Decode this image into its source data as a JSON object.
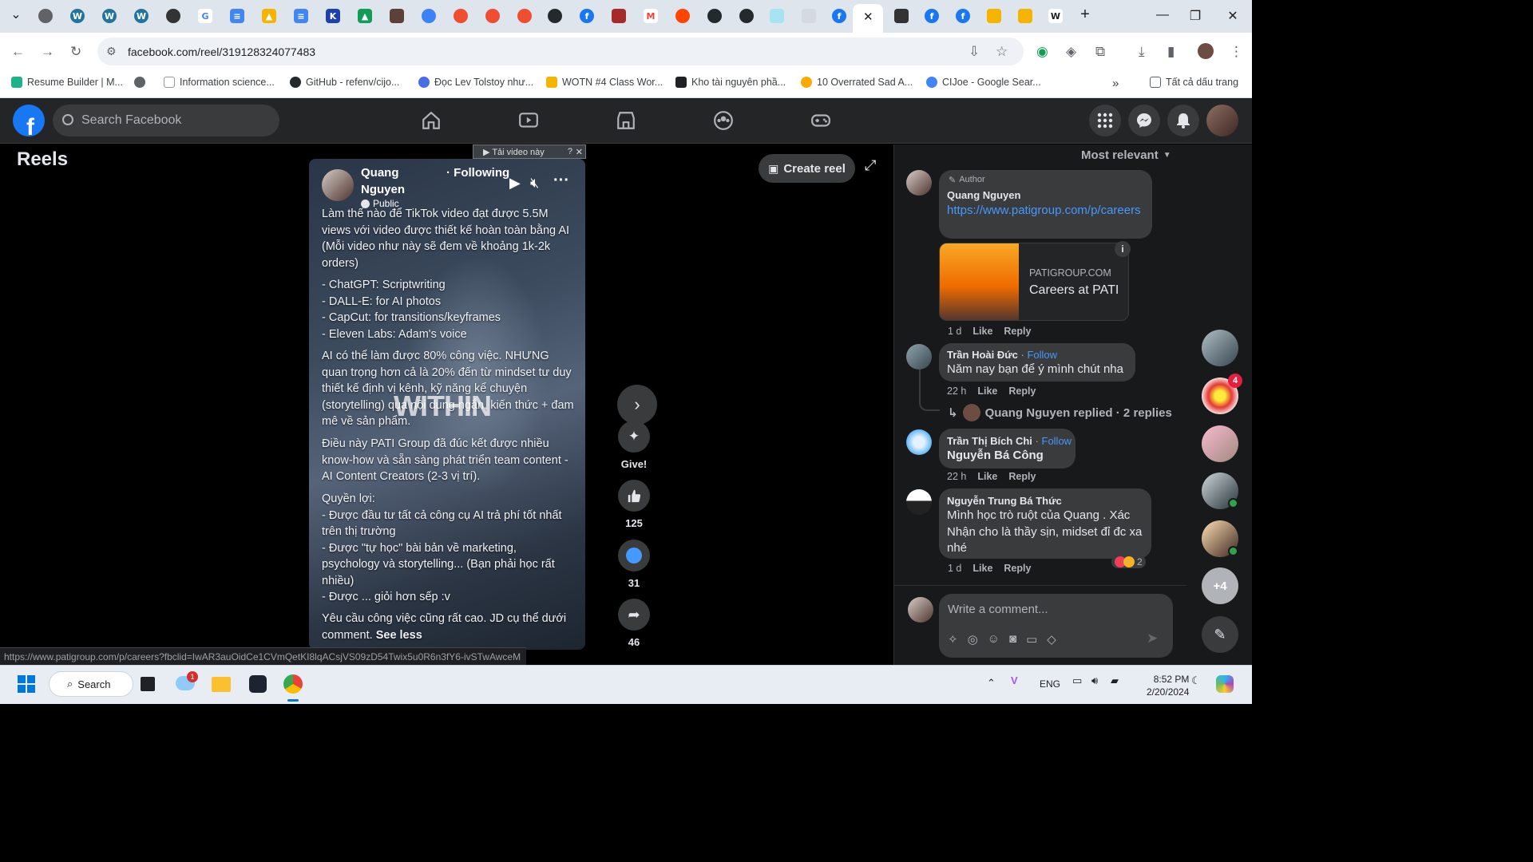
{
  "browser": {
    "url": "facebook.com/reel/319128324077483",
    "close_tab": "✕",
    "new_tab": "+"
  },
  "bookmarks": [
    {
      "label": "Resume Builder | M...",
      "color": "#1fb28a"
    },
    {
      "label": "",
      "color": "#5f6368"
    },
    {
      "label": "Information science...",
      "color": "#202124"
    },
    {
      "label": "GitHub - refenv/cijo...",
      "color": "#24292e"
    },
    {
      "label": "Đọc Lev Tolstoy như...",
      "color": "#4a6de5"
    },
    {
      "label": "WOTN #4 Class Wor...",
      "color": "#f4b400"
    },
    {
      "label": "Kho tài nguyên phầ...",
      "color": "#202124"
    },
    {
      "label": "10 Overrated Sad A...",
      "color": "#f9ab00"
    },
    {
      "label": "CIJoe - Google Sear...",
      "color": "#4285f4"
    }
  ],
  "bookmarks_more": "»",
  "all_bookmarks": "Tất cả dấu trang",
  "fb": {
    "search_placeholder": "Search Facebook",
    "logo_letter": "f"
  },
  "reels_title": "Reels",
  "download_bar": "▶ Tải video này",
  "create_reel": "Create reel",
  "video": {
    "author": "Quang Nguyen",
    "author_line1": "Quang",
    "author_line2": "Nguyen",
    "following": "· Following",
    "privacy": "Public",
    "p1": "Làm thế nào để TikTok video đạt được 5.5M views với video được thiết kế hoàn toàn bằng AI (Mỗi video như này sẽ đem về khoảng 1k-2k orders)",
    "p2_lines": [
      "- ChatGPT: Scriptwriting",
      "- DALL-E: for AI photos",
      "- CapCut: for transitions/keyframes",
      "- Eleven Labs: Adam's voice"
    ],
    "p3": "AI có thể làm được 80% công việc. NHƯNG quan trọng hơn cả là 20% đến từ mindset tư duy thiết kế định vị kênh, kỹ năng kể chuyện (storytelling) qua nội dung ngắn, kiến thức + đam mê về sản phẩm.",
    "p4": "Điều này PATI Group đã đúc kết được nhiều know-how và sẵn sàng phát triển team content - AI Content Creators (2-3 vị trí).",
    "p5_lines": [
      "Quyền lợi:",
      "- Được đầu tư tất cả công cụ AI trả phí tốt nhất trên thị trường",
      "- Được \"tự học\" bài bản về marketing, psychology và storytelling... (Bạn phải học rất nhiều)",
      "- Được ... giỏi hơn sếp :v"
    ],
    "p6": "Yêu cầu công việc cũng rất cao. JD cụ thể dưới comment.",
    "see_less": "See less",
    "overlay_word": "WITHIN"
  },
  "actions": {
    "give": "Give!",
    "likes": "125",
    "comments": "31",
    "shares": "46"
  },
  "comments_panel": {
    "sort": "Most relevant",
    "c1": {
      "badge": "Author",
      "name": "Quang Nguyen",
      "link": "https://www.patigroup.com/p/careers",
      "domain": "PATIGROUP.COM",
      "title": "Careers at PATI",
      "time": "1 d",
      "like": "Like",
      "reply": "Reply"
    },
    "c2": {
      "name": "Trần Hoài Đức",
      "follow": "Follow",
      "text": "Năm nay bạn để ý mình chút nha",
      "time": "22 h",
      "like": "Like",
      "reply": "Reply",
      "replies": "Quang Nguyen replied · 2 replies"
    },
    "c3": {
      "name": "Trần Thị Bích Chi",
      "follow": "Follow",
      "text": "Nguyễn Bá Công",
      "time": "22 h",
      "like": "Like",
      "reply": "Reply"
    },
    "c4": {
      "name": "Nguyễn Trung Bá Thức",
      "text": "Mình học trò ruột của Quang . Xác Nhận cho là thầy sịn, midset đỉ đc xa nhé",
      "time": "1 d",
      "like": "Like",
      "reply": "Reply",
      "reactions": "2"
    },
    "write_placeholder": "Write a comment..."
  },
  "contacts": {
    "badge": "4",
    "more": "+4"
  },
  "status_url": "https://www.patigroup.com/p/careers?fbclid=IwAR3auOidCe1CVmQetKI8lqACsjVS09zD54Twix5u0R6n3fY6-ivSTwAwceM",
  "taskbar": {
    "search": "Search",
    "lang": "ENG",
    "time": "8:52 PM",
    "date": "2/20/2024",
    "mail_badge": "1"
  },
  "colors": {
    "fb_blue": "#1877f2",
    "fb_dark": "#242526",
    "panel": "#18191a",
    "bubble": "#3a3b3c",
    "link": "#4599ff"
  }
}
